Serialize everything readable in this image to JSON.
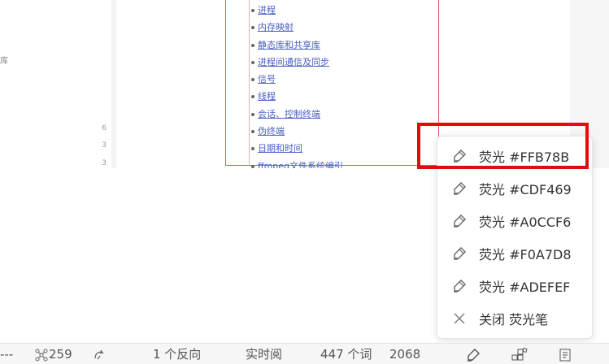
{
  "toc": {
    "items": [
      "进程",
      "内存映射",
      "静态库和共享库",
      "进程间通信及同步",
      "信号",
      "线程",
      "会话、控制终端",
      "伪终端",
      "日期和时间",
      "ffmpeg文件系统编引"
    ]
  },
  "left_sidebar": {
    "fragment": "库",
    "counts": [
      "6",
      "3",
      "3"
    ]
  },
  "menu": {
    "items": [
      {
        "label": "荧光 #FFB78B",
        "icon": "highlighter-icon",
        "color": "#FFB78B"
      },
      {
        "label": "荧光 #CDF469",
        "icon": "highlighter-icon",
        "color": "#CDF469"
      },
      {
        "label": "荧光 #A0CCF6",
        "icon": "highlighter-icon",
        "color": "#A0CCF6"
      },
      {
        "label": "荧光 #F0A7D8",
        "icon": "highlighter-icon",
        "color": "#F0A7D8"
      },
      {
        "label": "荧光 #ADEFEF",
        "icon": "highlighter-icon",
        "color": "#ADEFEF"
      },
      {
        "label": "关闭 荧光笔",
        "icon": "close-icon"
      }
    ],
    "highlighted_index": 0
  },
  "status_bar": {
    "dashes": "---",
    "graph_count": "259",
    "backlinks": "1 个反向",
    "live_preview": "实时阅",
    "word_count": "447 个词",
    "char_count": "2068"
  },
  "colors": {
    "highlight_frame": "#E00D0D",
    "link": "#4A5FC1"
  }
}
